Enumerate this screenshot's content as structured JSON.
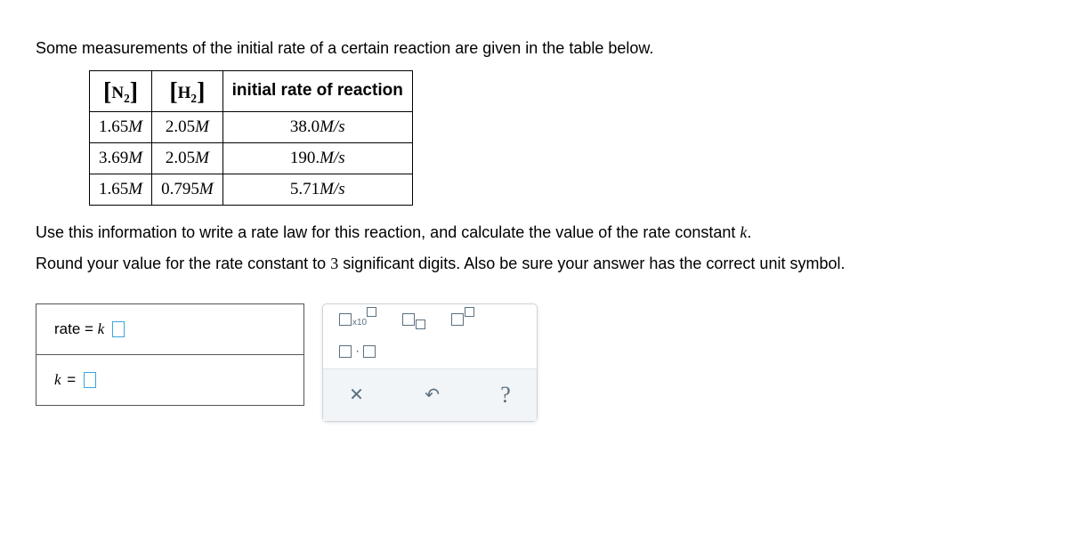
{
  "intro": "Some measurements of the initial rate of a certain reaction are given in the table below.",
  "table": {
    "headers": {
      "n2": "N",
      "n2_sub": "2",
      "h2": "H",
      "h2_sub": "2",
      "rate": "initial rate of reaction"
    },
    "rows": [
      {
        "n2": "1.65",
        "h2": "2.05",
        "rate": "38.0",
        "rate_unit": "M/s"
      },
      {
        "n2": "3.69",
        "h2": "2.05",
        "rate": "190.",
        "rate_unit": "M/s"
      },
      {
        "n2": "1.65",
        "h2": "0.795",
        "rate": "5.71",
        "rate_unit": "M/s"
      }
    ],
    "conc_unit": "M"
  },
  "instr1": "Use this information to write a rate law for this reaction, and calculate the value of the rate constant ",
  "instr1_var": "k",
  "instr1_end": ".",
  "instr2a": "Round your value for the rate constant to ",
  "instr2_sig": "3",
  "instr2b": " significant digits. Also be sure your answer has the correct unit symbol.",
  "answers": {
    "rate_prefix": "rate = ",
    "rate_k": "k",
    "k_prefix": "k = "
  },
  "tools": {
    "x10_label": "x10"
  }
}
